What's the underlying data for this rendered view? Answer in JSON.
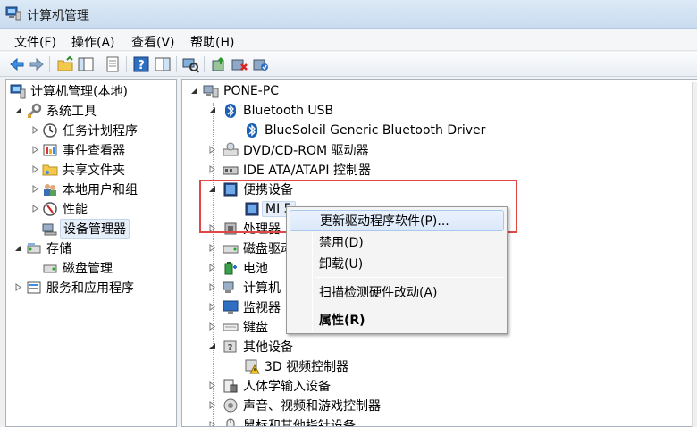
{
  "window": {
    "title": "计算机管理"
  },
  "menu": [
    "文件(F)",
    "操作(A)",
    "查看(V)",
    "帮助(H)"
  ],
  "toolbar": [
    "back-icon",
    "forward-icon",
    "up-folder-icon",
    "show-tree-icon",
    "properties-icon",
    "help-icon",
    "console-icon",
    "scan-hardware-icon",
    "update-driver-icon",
    "disable-device-icon",
    "uninstall-device-icon"
  ],
  "left_tree": {
    "root": "计算机管理(本地)",
    "system_tools": "系统工具",
    "task_scheduler": "任务计划程序",
    "event_viewer": "事件查看器",
    "shared_folders": "共享文件夹",
    "local_users": "本地用户和组",
    "performance": "性能",
    "device_manager": "设备管理器",
    "storage": "存储",
    "disk_mgmt": "磁盘管理",
    "services_apps": "服务和应用程序"
  },
  "device_tree": {
    "computer": "PONE-PC",
    "bluetooth": "Bluetooth USB",
    "bluetooth_driver": "BlueSoleil Generic Bluetooth Driver",
    "dvd": "DVD/CD-ROM 驱动器",
    "ide": "IDE ATA/ATAPI 控制器",
    "portable": "便携设备",
    "mi": "MI 5",
    "processor": "处理器",
    "disk": "磁盘驱动器",
    "battery": "电池",
    "computer_node": "计算机",
    "monitor": "监视器",
    "keyboard": "键盘",
    "other_devices": "其他设备",
    "video_controller": "3D 视频控制器",
    "hid": "人体学输入设备",
    "sound": "声音、视频和游戏控制器",
    "mouse": "鼠标和其他指针设备"
  },
  "context_menu": {
    "update_driver": "更新驱动程序软件(P)...",
    "disable": "禁用(D)",
    "uninstall": "卸载(U)",
    "scan": "扫描检测硬件改动(A)",
    "properties": "属性(R)"
  }
}
